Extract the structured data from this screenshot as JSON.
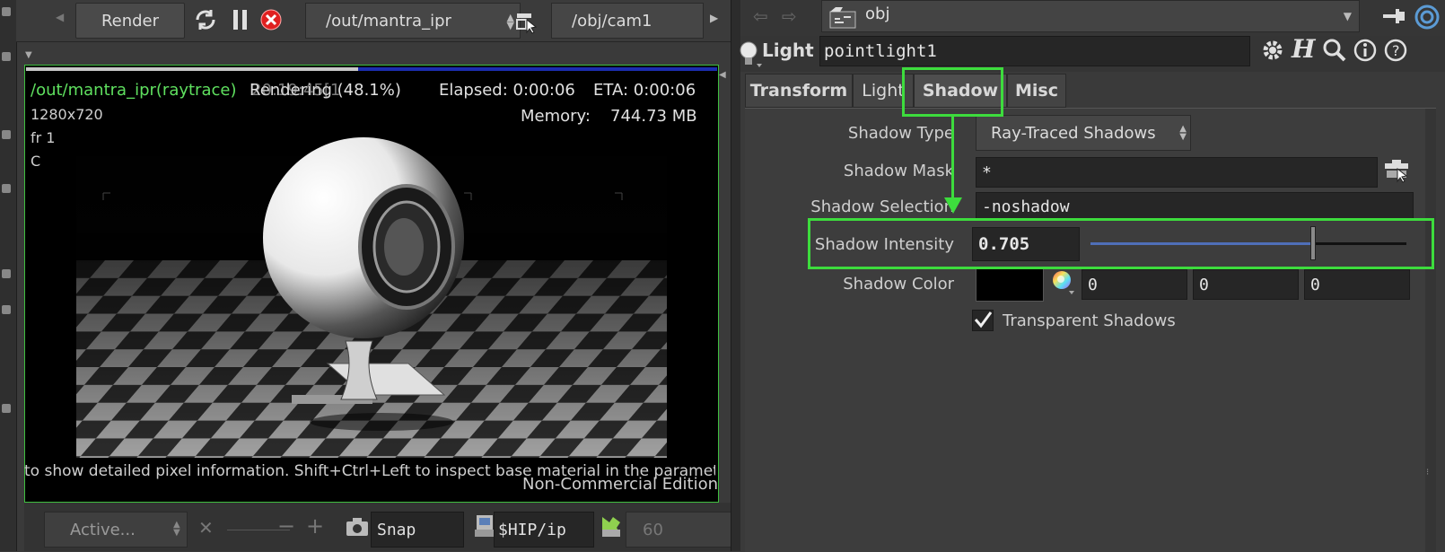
{
  "render_toolbar": {
    "render_label": "Render",
    "rop_path": "/out/mantra_ipr",
    "camera_path": "/obj/cam1"
  },
  "viewer": {
    "title": "/out/mantra_ipr(raytrace)",
    "status": "Rendering (48.1%)",
    "overlap_time": "20:19:45[1",
    "elapsed": "Elapsed: 0:00:06",
    "eta": "ETA: 0:00:06",
    "resolution": "1280x720",
    "memory_label": "Memory:",
    "memory_value": "744.73 MB",
    "frame": "fr 1",
    "channel": "C",
    "progress": 0.481,
    "hint": "to show detailed pixel information. Shift+Ctrl+Left to inspect base material in the paramet",
    "edition": "Non-Commercial Edition"
  },
  "bottom_bar": {
    "active_label": "Active...",
    "snap_label": "Snap",
    "output_path": "$HIP/ip",
    "frame_value": "60"
  },
  "network": {
    "path": "obj"
  },
  "parameters": {
    "node_type": "Light",
    "node_name": "pointlight1",
    "tabs": [
      {
        "label": "Transform",
        "active": false
      },
      {
        "label": "Light",
        "active": false
      },
      {
        "label": "Shadow",
        "active": true
      },
      {
        "label": "Misc",
        "active": false
      }
    ],
    "shadow_type_label": "Shadow Type",
    "shadow_type_value": "Ray-Traced Shadows",
    "shadow_mask_label": "Shadow Mask",
    "shadow_mask_value": "*",
    "shadow_selection_label": "Shadow Selection",
    "shadow_selection_value": "-noshadow",
    "shadow_intensity_label": "Shadow Intensity",
    "shadow_intensity_value": "0.705",
    "shadow_intensity_fraction": 0.705,
    "shadow_color_label": "Shadow Color",
    "shadow_color_r": "0",
    "shadow_color_g": "0",
    "shadow_color_b": "0",
    "transparent_shadows_label": "Transparent Shadows",
    "transparent_shadows_checked": true
  },
  "colors": {
    "highlight": "#3ddc3d",
    "viewer_title": "#5fe05f",
    "progress_bar": "#1b2db0"
  }
}
